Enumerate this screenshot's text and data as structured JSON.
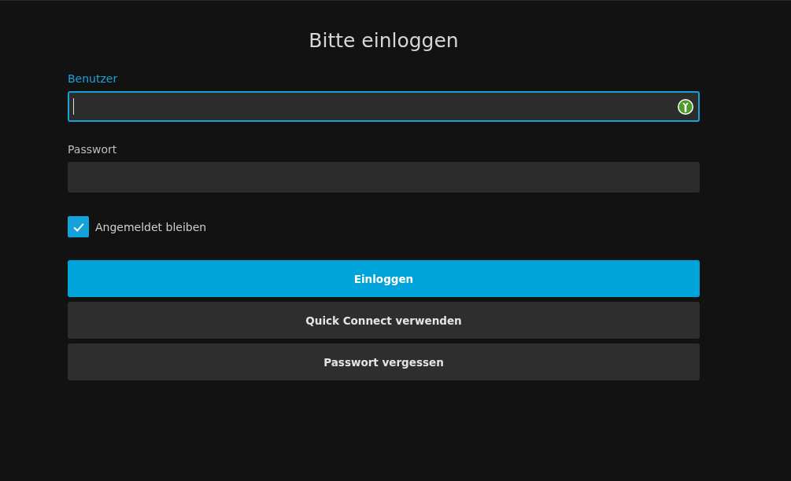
{
  "title": "Bitte einloggen",
  "fields": [
    {
      "kind": "username",
      "label": "Benutzer",
      "focused": true
    },
    {
      "kind": "password",
      "label": "Passwort",
      "focused": false
    }
  ],
  "remember": {
    "label": "Angemeldet bleiben",
    "checked": true
  },
  "buttons": [
    {
      "label": "Einloggen",
      "primary": true
    },
    {
      "label": "Quick Connect verwenden",
      "primary": false
    },
    {
      "label": "Passwort vergessen",
      "primary": false
    }
  ]
}
